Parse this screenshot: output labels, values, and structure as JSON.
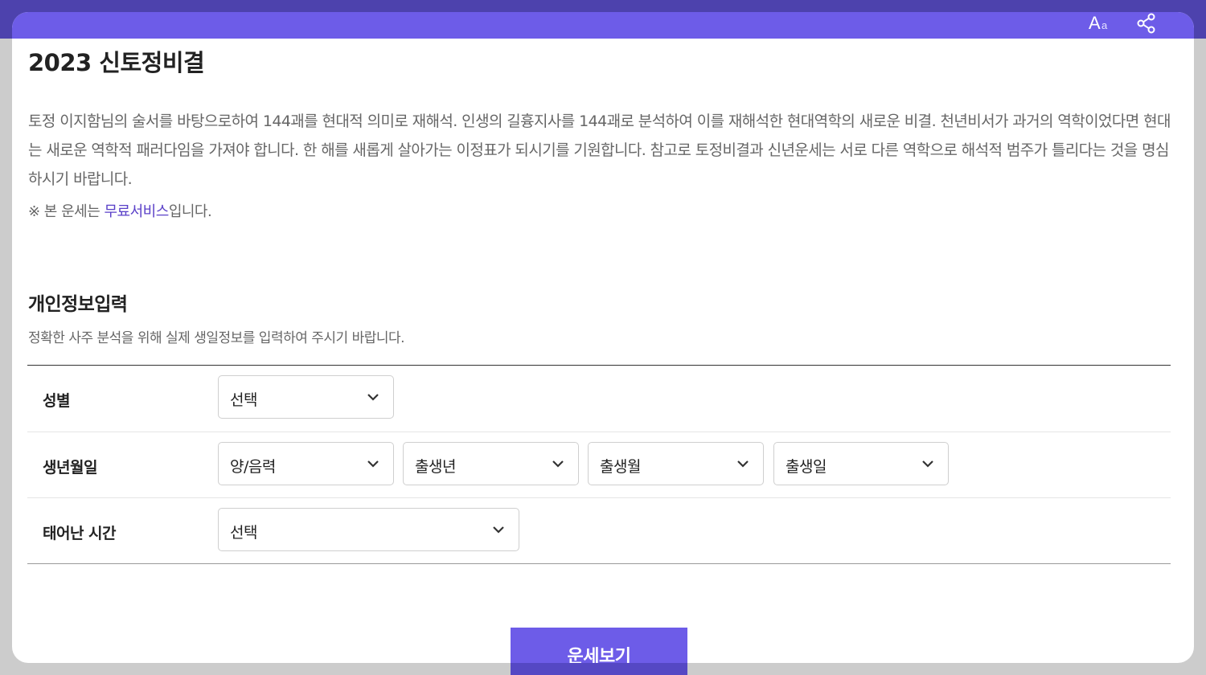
{
  "header": {
    "font_size_btn": {
      "big": "A",
      "small": "a",
      "icon": "font-size-icon"
    },
    "share_icon": "share-icon",
    "bar_color": "#6d5ce8"
  },
  "page": {
    "title": "2023 신토정비결",
    "description": "토정 이지함님의 술서를 바탕으로하여 144괘를 현대적 의미로 재해석. 인생의 길흉지사를 144괘로 분석하여 이를 재해석한 현대역학의 새로운 비결. 천년비서가 과거의 역학이었다면 현대는 새로운 역학적 패러다임을 가져야 합니다. 한 해를 새롭게 살아가는 이정표가 되시기를 기원합니다. 참고로 토정비결과 신년운세는 서로 다른 역학으로 해석적 범주가 틀리다는 것을 명심하시기 바랍니다.",
    "notice_prefix": "※ 본 운세는 ",
    "notice_link": "무료서비스",
    "notice_suffix": "입니다."
  },
  "form": {
    "section_title": "개인정보입력",
    "section_desc": "정확한 사주 분석을 위해 실제 생일정보를 입력하여 주시기 바랍니다.",
    "rows": [
      {
        "label": "성별",
        "selects": [
          "선택"
        ]
      },
      {
        "label": "생년월일",
        "selects": [
          "양/음력",
          "출생년",
          "출생월",
          "출생일"
        ]
      },
      {
        "label": "태어난 시간",
        "selects": [
          "선택"
        ]
      }
    ]
  },
  "submit_label": "운세보기",
  "colors": {
    "accent": "#6d5ce8",
    "link": "#5a40c8"
  }
}
